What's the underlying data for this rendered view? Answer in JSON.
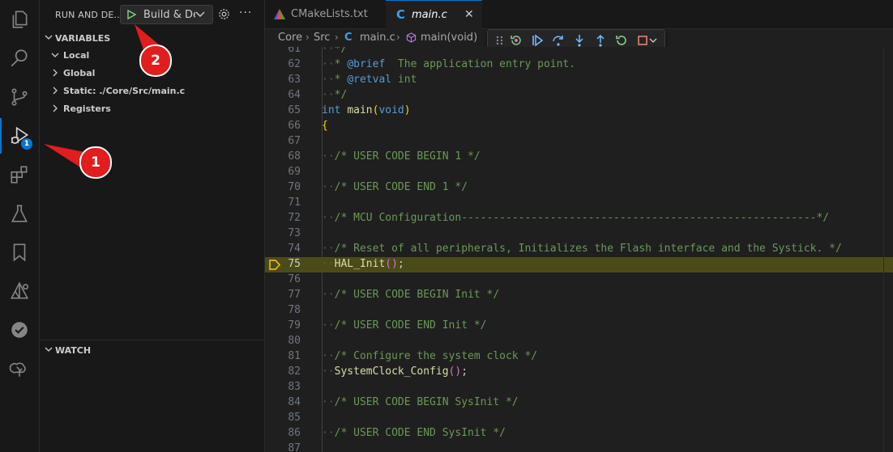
{
  "sidebar": {
    "title": "RUN AND DE...",
    "run_config": "Build & Debug",
    "more": "···",
    "variables_header": "VARIABLES",
    "tree": [
      {
        "label": "Local",
        "expanded": true
      },
      {
        "label": "Global",
        "expanded": false
      },
      {
        "label": "Static: ./Core/Src/main.c",
        "expanded": false
      },
      {
        "label": "Registers",
        "expanded": false
      }
    ],
    "watch_header": "WATCH"
  },
  "activity_badge": "1",
  "tabs": [
    {
      "label": "CMakeLists.txt",
      "active": false
    },
    {
      "label": "main.c",
      "active": true,
      "close": "✕"
    }
  ],
  "breadcrumb": [
    "Core",
    "Src",
    "main.c",
    "main(void)"
  ],
  "editor": {
    "current_line": "75",
    "lines": [
      {
        "n": "61",
        "t": "*/"
      },
      {
        "n": "62",
        "t": "* @brief  The application entry point."
      },
      {
        "n": "63",
        "t": "* @retval int"
      },
      {
        "n": "64",
        "t": "*/"
      },
      {
        "n": "65",
        "t": "int main(void)"
      },
      {
        "n": "66",
        "t": "{"
      },
      {
        "n": "67",
        "t": ""
      },
      {
        "n": "68",
        "t": "/* USER CODE BEGIN 1 */"
      },
      {
        "n": "69",
        "t": ""
      },
      {
        "n": "70",
        "t": "/* USER CODE END 1 */"
      },
      {
        "n": "71",
        "t": ""
      },
      {
        "n": "72",
        "t": "/* MCU Configuration--------------------------------------------------------*/"
      },
      {
        "n": "73",
        "t": ""
      },
      {
        "n": "74",
        "t": "/* Reset of all peripherals, Initializes the Flash interface and the Systick. */"
      },
      {
        "n": "75",
        "t": "HAL_Init();"
      },
      {
        "n": "76",
        "t": ""
      },
      {
        "n": "77",
        "t": "/* USER CODE BEGIN Init */"
      },
      {
        "n": "78",
        "t": ""
      },
      {
        "n": "79",
        "t": "/* USER CODE END Init */"
      },
      {
        "n": "80",
        "t": ""
      },
      {
        "n": "81",
        "t": "/* Configure the system clock */"
      },
      {
        "n": "82",
        "t": "SystemClock_Config();"
      },
      {
        "n": "83",
        "t": ""
      },
      {
        "n": "84",
        "t": "/* USER CODE BEGIN SysInit */"
      },
      {
        "n": "85",
        "t": ""
      },
      {
        "n": "86",
        "t": "/* USER CODE END SysInit */"
      },
      {
        "n": "87",
        "t": ""
      }
    ]
  },
  "callouts": [
    "1",
    "2"
  ],
  "colors": {
    "accent": "#0078d4",
    "callout": "#e11d1d",
    "current_line": "#4b4b18"
  }
}
